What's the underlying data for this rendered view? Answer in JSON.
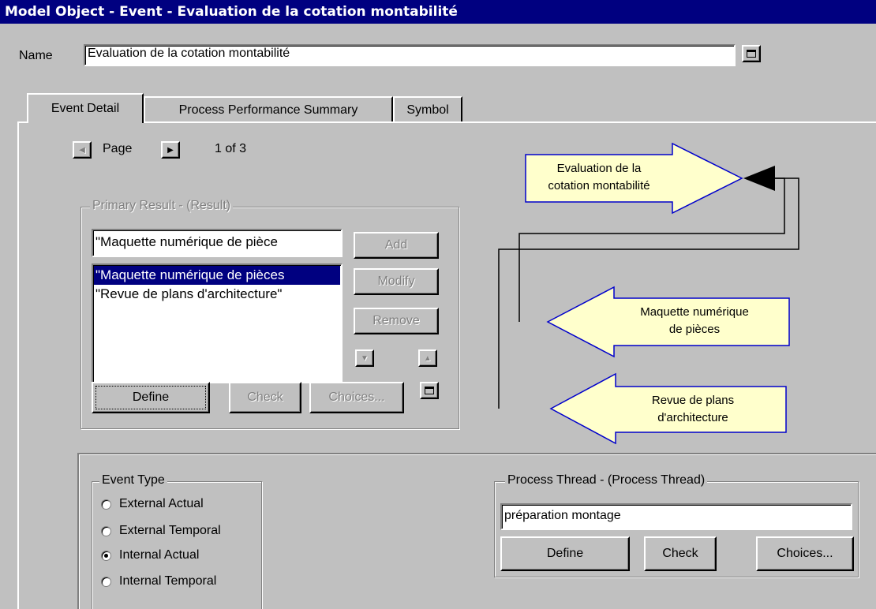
{
  "window": {
    "title": "Model Object - Event - Evaluation de la cotation montabilité"
  },
  "name_field": {
    "label": "Name",
    "value": "Evaluation de la cotation montabilité"
  },
  "tabs": [
    {
      "label": "Event Detail",
      "active": true
    },
    {
      "label": "Process Performance Summary",
      "active": false
    },
    {
      "label": "Symbol",
      "active": false
    }
  ],
  "pager": {
    "label": "Page",
    "status": "1 of 3"
  },
  "primary_result": {
    "title": "Primary Result - (Result)",
    "input_value": "\"Maquette numérique de pièce",
    "items": [
      {
        "text": "\"Maquette numérique de pièces",
        "selected": true
      },
      {
        "text": "\"Revue de plans d'architecture\"",
        "selected": false
      }
    ],
    "buttons": {
      "add": "Add",
      "modify": "Modify",
      "remove": "Remove",
      "define": "Define",
      "check": "Check",
      "choices": "Choices..."
    }
  },
  "event_type": {
    "title": "Event Type",
    "options": [
      {
        "label": "External Actual",
        "checked": false
      },
      {
        "label": "External Temporal",
        "checked": false
      },
      {
        "label": "Internal Actual",
        "checked": true
      },
      {
        "label": "Internal Temporal",
        "checked": false
      }
    ]
  },
  "process_thread": {
    "title": "Process Thread - (Process Thread)",
    "value": "préparation montage",
    "buttons": {
      "define": "Define",
      "check": "Check",
      "choices": "Choices..."
    }
  },
  "diagram": {
    "event_label": "Evaluation de la cotation montabilité",
    "event_line1": "Evaluation de la",
    "event_line2": "cotation montabilité",
    "input1_line1": "Maquette numérique",
    "input1_line2": "de pièces",
    "input2_line1": "Revue de plans",
    "input2_line2": "d'architecture",
    "fill_color": "#ffffcc",
    "stroke_color": "#0000cc"
  },
  "colors": {
    "titlebar": "#000080",
    "face": "#c0c0c0",
    "selection": "#000080"
  }
}
